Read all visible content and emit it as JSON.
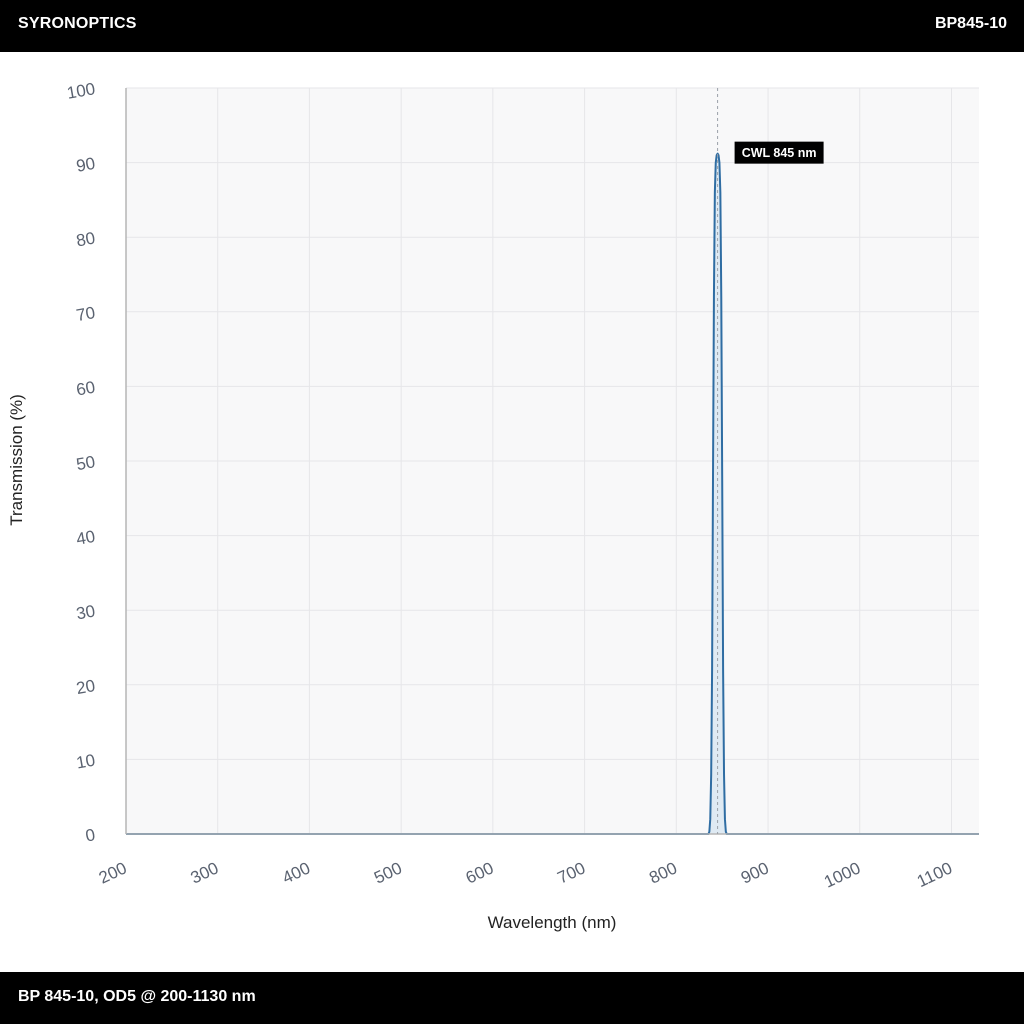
{
  "header": {
    "brand": "SYRONOPTICS",
    "part_number": "BP845-10"
  },
  "footer": {
    "description": "BP 845-10, OD5 @ 200-1130 nm"
  },
  "chart_data": {
    "type": "line",
    "title": "",
    "xlabel": "Wavelength (nm)",
    "ylabel": "Transmission (%)",
    "xlim": [
      200,
      1130
    ],
    "ylim": [
      0,
      100
    ],
    "x_ticks": [
      200,
      300,
      400,
      500,
      600,
      700,
      800,
      900,
      1000,
      1100
    ],
    "y_ticks": [
      0,
      10,
      20,
      30,
      40,
      50,
      60,
      70,
      80,
      90,
      100
    ],
    "grid": true,
    "series": [
      {
        "color": "#2f6da3",
        "fill": "#dce8f2",
        "x": [
          200,
          835,
          836,
          837,
          838,
          839,
          840,
          841,
          842,
          843,
          844,
          845,
          846,
          847,
          848,
          849,
          850,
          851,
          852,
          853,
          854,
          855,
          1130
        ],
        "y": [
          0,
          0,
          0.3,
          2,
          8,
          22,
          48,
          72,
          86,
          90,
          91,
          91.2,
          91,
          90,
          86,
          72,
          48,
          22,
          8,
          2,
          0.3,
          0,
          0
        ]
      }
    ],
    "annotations": [
      {
        "label": "CWL 845 nm",
        "x": 845,
        "y": 91.2
      }
    ]
  }
}
